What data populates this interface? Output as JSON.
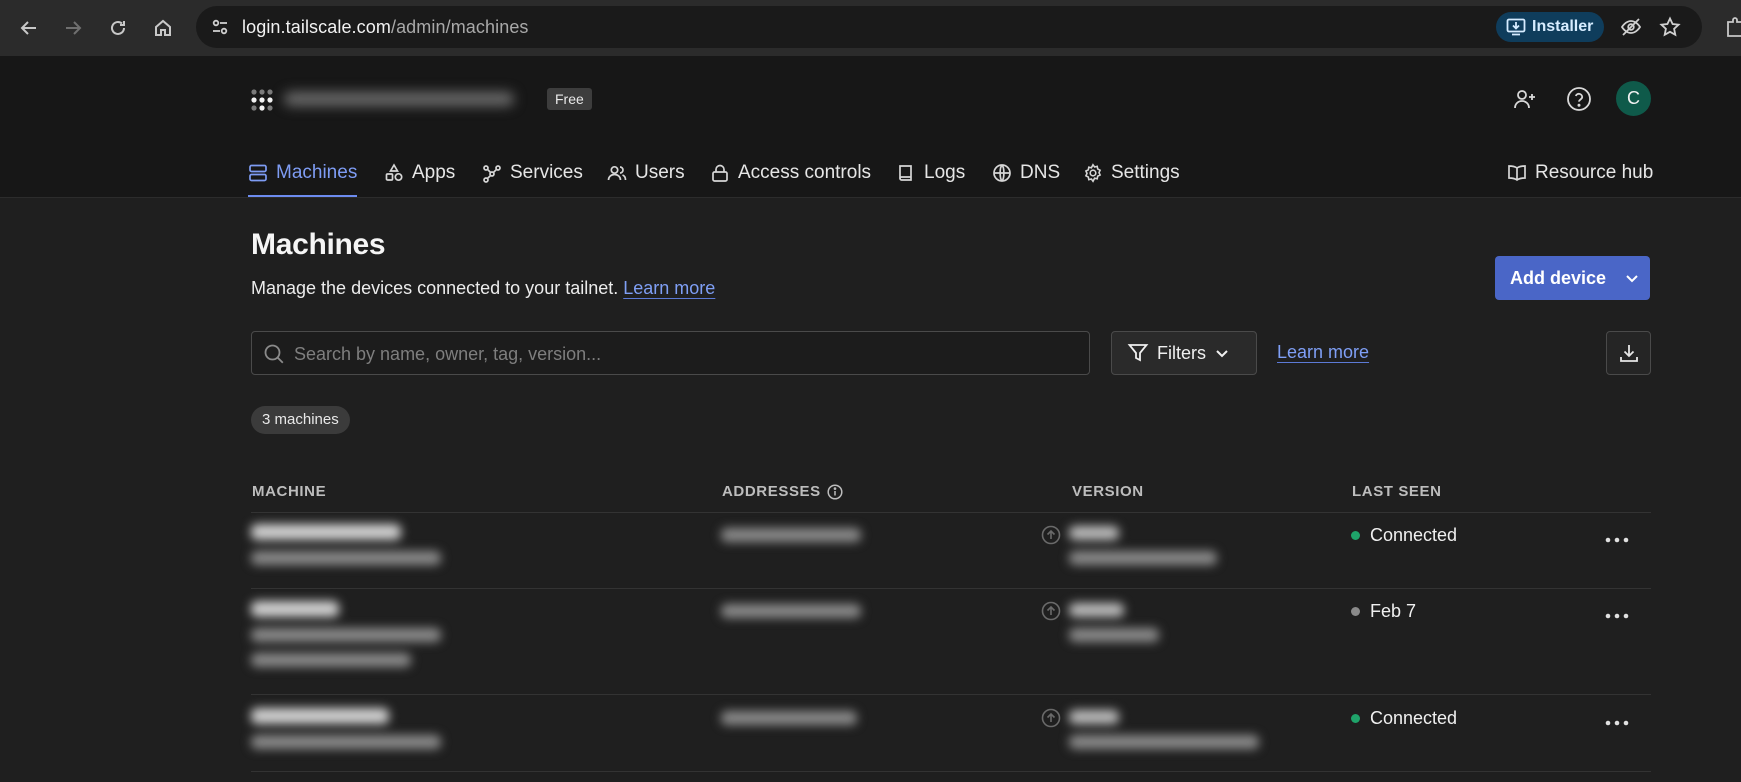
{
  "browser": {
    "url_host": "login.tailscale.com",
    "url_path": "/admin/machines",
    "install_label": "Installer"
  },
  "header": {
    "plan_badge": "Free",
    "avatar_initial": "C"
  },
  "tabs": [
    {
      "label": "Machines",
      "icon": "server-icon",
      "active": true
    },
    {
      "label": "Apps",
      "icon": "shapes-icon",
      "active": false
    },
    {
      "label": "Services",
      "icon": "network-icon",
      "active": false
    },
    {
      "label": "Users",
      "icon": "users-icon",
      "active": false
    },
    {
      "label": "Access controls",
      "icon": "lock-icon",
      "active": false
    },
    {
      "label": "Logs",
      "icon": "book-icon",
      "active": false
    },
    {
      "label": "DNS",
      "icon": "globe-icon",
      "active": false
    },
    {
      "label": "Settings",
      "icon": "gear-icon",
      "active": false
    }
  ],
  "resource_hub_label": "Resource hub",
  "main": {
    "title": "Machines",
    "subtitle": "Manage the devices connected to your tailnet.",
    "subtitle_link": "Learn more",
    "add_device_label": "Add device",
    "search_placeholder": "Search by name, owner, tag, version...",
    "filters_label": "Filters",
    "filters_link": "Learn more",
    "machine_count": "3 machines"
  },
  "table": {
    "columns": {
      "machine": "MACHINE",
      "addresses": "ADDRESSES",
      "version": "VERSION",
      "last_seen": "LAST SEEN"
    },
    "rows": [
      {
        "last_seen": "Connected",
        "status_color": "#1fa36a"
      },
      {
        "last_seen": "Feb 7",
        "status_color": "#8a8a8a"
      },
      {
        "last_seen": "Connected",
        "status_color": "#1fa36a"
      }
    ]
  },
  "colors": {
    "accent": "#7e9cf3",
    "primary_button": "#4a66c7",
    "connected": "#1fa36a"
  }
}
